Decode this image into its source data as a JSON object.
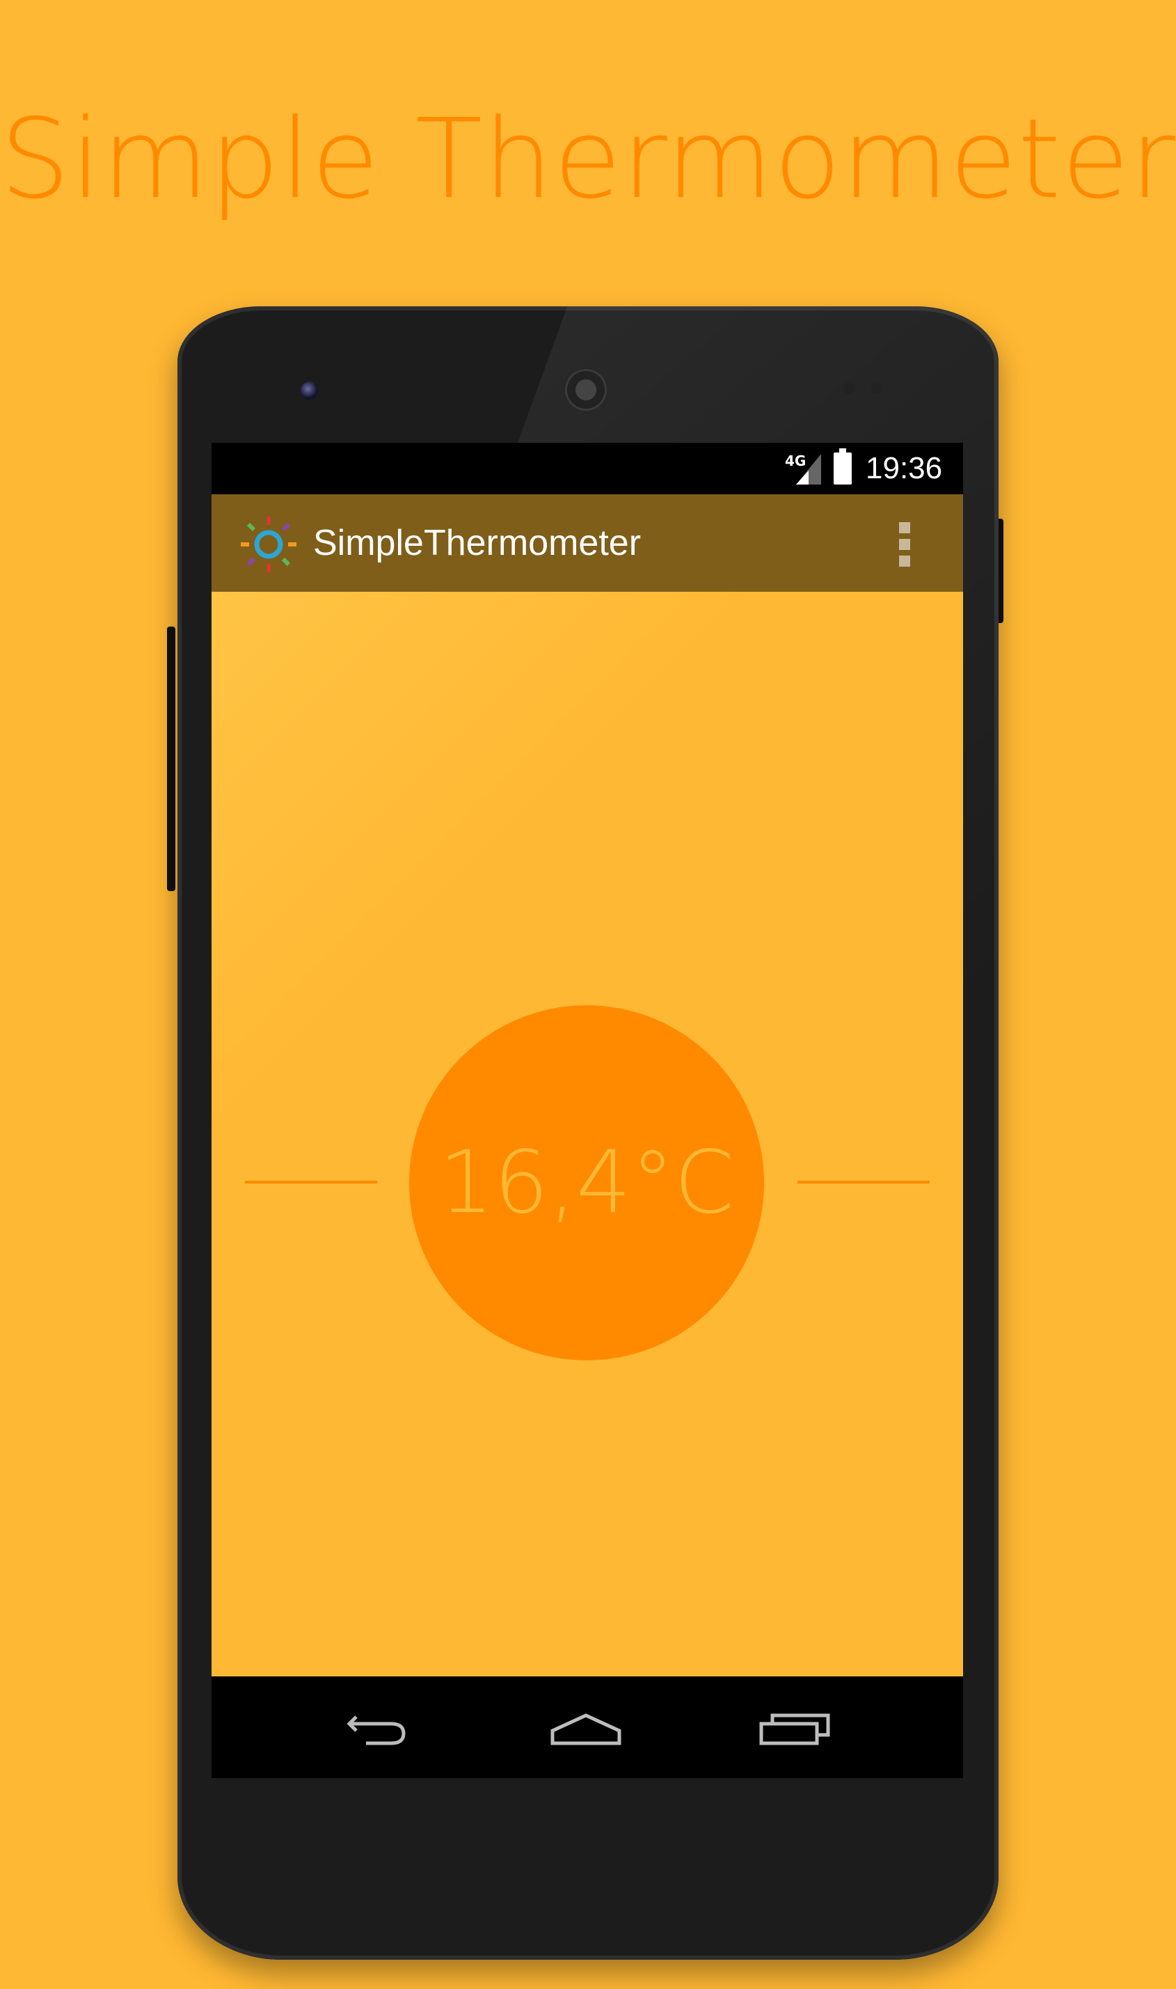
{
  "promo": {
    "title": "Simple Thermometer"
  },
  "status_bar": {
    "network": "4G",
    "time": "19:36"
  },
  "action_bar": {
    "app_title": "SimpleThermometer",
    "app_icon": "sun-icon",
    "overflow_icon": "more-vert-icon"
  },
  "thermometer": {
    "temperature": "16,4°C"
  },
  "nav_bar": {
    "back_icon": "back-icon",
    "home_icon": "home-icon",
    "recents_icon": "recents-icon"
  },
  "colors": {
    "background": "#FFB833",
    "accent": "#FF8A00",
    "action_bar": "#7F5E1A"
  }
}
